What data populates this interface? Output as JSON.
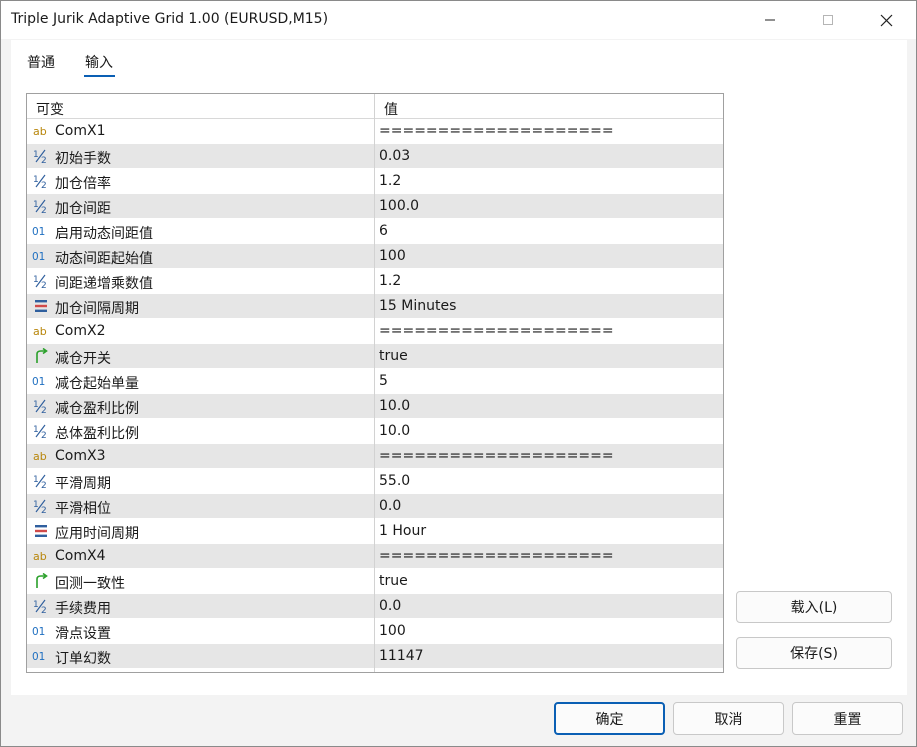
{
  "window": {
    "title": "Triple Jurik Adaptive Grid 1.00 (EURUSD,M15)"
  },
  "tabs": [
    {
      "label": "普通"
    },
    {
      "label": "输入"
    }
  ],
  "grid": {
    "columns": [
      "可变",
      "值"
    ],
    "rows": [
      {
        "icon": "string-icon",
        "name": "ComX1",
        "value": "===================="
      },
      {
        "icon": "double-icon",
        "name": "初始手数",
        "value": "0.03"
      },
      {
        "icon": "double-icon",
        "name": "加仓倍率",
        "value": "1.2"
      },
      {
        "icon": "double-icon",
        "name": "加仓间距",
        "value": "100.0"
      },
      {
        "icon": "integer-icon",
        "name": "启用动态间距值",
        "value": "6"
      },
      {
        "icon": "integer-icon",
        "name": "动态间距起始值",
        "value": "100"
      },
      {
        "icon": "double-icon",
        "name": "间距递增乘数值",
        "value": "1.2"
      },
      {
        "icon": "enum-icon",
        "name": "加仓间隔周期",
        "value": "15 Minutes"
      },
      {
        "icon": "string-icon",
        "name": "ComX2",
        "value": "===================="
      },
      {
        "icon": "bool-icon",
        "name": "减仓开关",
        "value": "true"
      },
      {
        "icon": "integer-icon",
        "name": "减仓起始单量",
        "value": "5"
      },
      {
        "icon": "double-icon",
        "name": "减仓盈利比例",
        "value": "10.0"
      },
      {
        "icon": "double-icon",
        "name": "总体盈利比例",
        "value": "10.0"
      },
      {
        "icon": "string-icon",
        "name": "ComX3",
        "value": "===================="
      },
      {
        "icon": "double-icon",
        "name": "平滑周期",
        "value": "55.0"
      },
      {
        "icon": "double-icon",
        "name": "平滑相位",
        "value": "0.0"
      },
      {
        "icon": "enum-icon",
        "name": "应用时间周期",
        "value": "1 Hour"
      },
      {
        "icon": "string-icon",
        "name": "ComX4",
        "value": "===================="
      },
      {
        "icon": "bool-icon",
        "name": "回测一致性",
        "value": "true"
      },
      {
        "icon": "double-icon",
        "name": "手续费用",
        "value": "0.0"
      },
      {
        "icon": "integer-icon",
        "name": "滑点设置",
        "value": "100"
      },
      {
        "icon": "integer-icon",
        "name": "订单幻数",
        "value": "11147"
      }
    ]
  },
  "side_buttons": {
    "load": "载入(L)",
    "save": "保存(S)"
  },
  "footer": {
    "ok": "确定",
    "cancel": "取消",
    "reset": "重置"
  },
  "colors": {
    "accent": "#0a5fb4",
    "row_alt": "#e6e6e6",
    "string_icon": "#b8860b",
    "double_icon": "#2f5f9e",
    "integer_icon": "#1f6fc0",
    "bool_icon": "#2aa02a",
    "enum_icon": "#d04a4a"
  }
}
